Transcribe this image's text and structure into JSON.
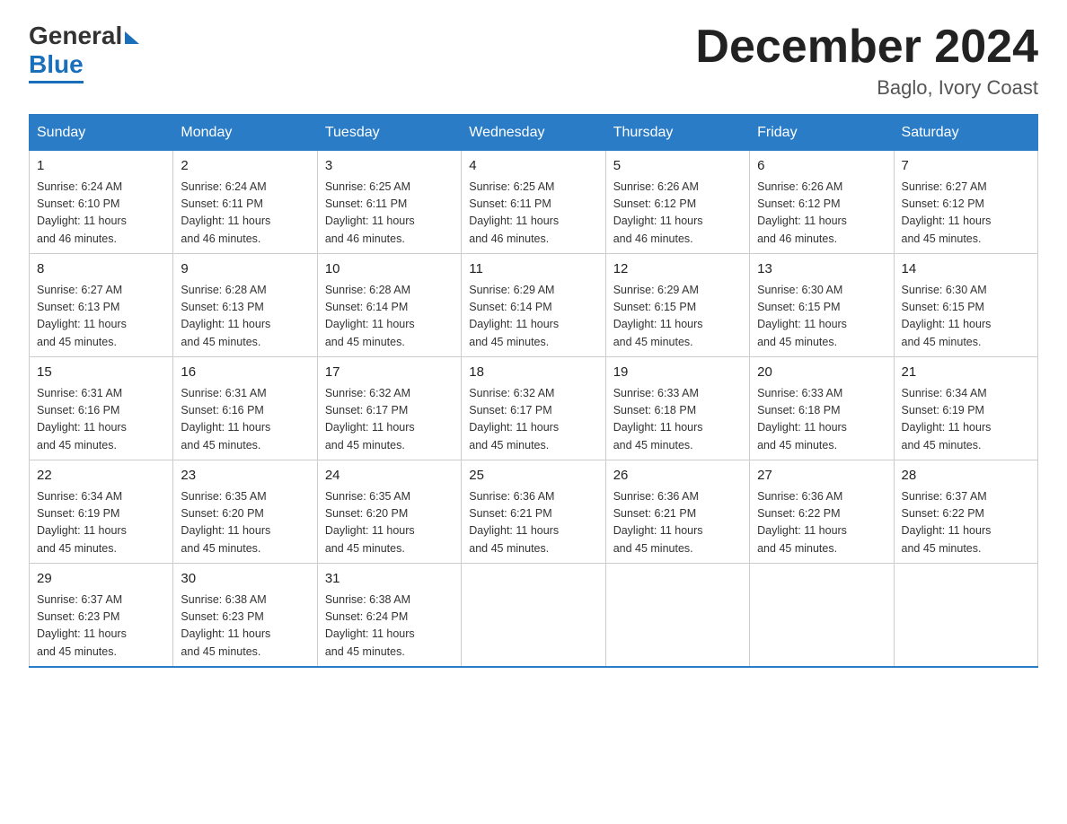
{
  "header": {
    "logo_general": "General",
    "logo_blue": "Blue",
    "month_year": "December 2024",
    "location": "Baglo, Ivory Coast"
  },
  "days_of_week": [
    "Sunday",
    "Monday",
    "Tuesday",
    "Wednesday",
    "Thursday",
    "Friday",
    "Saturday"
  ],
  "weeks": [
    [
      {
        "day": "1",
        "sunrise": "6:24 AM",
        "sunset": "6:10 PM",
        "daylight": "11 hours and 46 minutes."
      },
      {
        "day": "2",
        "sunrise": "6:24 AM",
        "sunset": "6:11 PM",
        "daylight": "11 hours and 46 minutes."
      },
      {
        "day": "3",
        "sunrise": "6:25 AM",
        "sunset": "6:11 PM",
        "daylight": "11 hours and 46 minutes."
      },
      {
        "day": "4",
        "sunrise": "6:25 AM",
        "sunset": "6:11 PM",
        "daylight": "11 hours and 46 minutes."
      },
      {
        "day": "5",
        "sunrise": "6:26 AM",
        "sunset": "6:12 PM",
        "daylight": "11 hours and 46 minutes."
      },
      {
        "day": "6",
        "sunrise": "6:26 AM",
        "sunset": "6:12 PM",
        "daylight": "11 hours and 46 minutes."
      },
      {
        "day": "7",
        "sunrise": "6:27 AM",
        "sunset": "6:12 PM",
        "daylight": "11 hours and 45 minutes."
      }
    ],
    [
      {
        "day": "8",
        "sunrise": "6:27 AM",
        "sunset": "6:13 PM",
        "daylight": "11 hours and 45 minutes."
      },
      {
        "day": "9",
        "sunrise": "6:28 AM",
        "sunset": "6:13 PM",
        "daylight": "11 hours and 45 minutes."
      },
      {
        "day": "10",
        "sunrise": "6:28 AM",
        "sunset": "6:14 PM",
        "daylight": "11 hours and 45 minutes."
      },
      {
        "day": "11",
        "sunrise": "6:29 AM",
        "sunset": "6:14 PM",
        "daylight": "11 hours and 45 minutes."
      },
      {
        "day": "12",
        "sunrise": "6:29 AM",
        "sunset": "6:15 PM",
        "daylight": "11 hours and 45 minutes."
      },
      {
        "day": "13",
        "sunrise": "6:30 AM",
        "sunset": "6:15 PM",
        "daylight": "11 hours and 45 minutes."
      },
      {
        "day": "14",
        "sunrise": "6:30 AM",
        "sunset": "6:15 PM",
        "daylight": "11 hours and 45 minutes."
      }
    ],
    [
      {
        "day": "15",
        "sunrise": "6:31 AM",
        "sunset": "6:16 PM",
        "daylight": "11 hours and 45 minutes."
      },
      {
        "day": "16",
        "sunrise": "6:31 AM",
        "sunset": "6:16 PM",
        "daylight": "11 hours and 45 minutes."
      },
      {
        "day": "17",
        "sunrise": "6:32 AM",
        "sunset": "6:17 PM",
        "daylight": "11 hours and 45 minutes."
      },
      {
        "day": "18",
        "sunrise": "6:32 AM",
        "sunset": "6:17 PM",
        "daylight": "11 hours and 45 minutes."
      },
      {
        "day": "19",
        "sunrise": "6:33 AM",
        "sunset": "6:18 PM",
        "daylight": "11 hours and 45 minutes."
      },
      {
        "day": "20",
        "sunrise": "6:33 AM",
        "sunset": "6:18 PM",
        "daylight": "11 hours and 45 minutes."
      },
      {
        "day": "21",
        "sunrise": "6:34 AM",
        "sunset": "6:19 PM",
        "daylight": "11 hours and 45 minutes."
      }
    ],
    [
      {
        "day": "22",
        "sunrise": "6:34 AM",
        "sunset": "6:19 PM",
        "daylight": "11 hours and 45 minutes."
      },
      {
        "day": "23",
        "sunrise": "6:35 AM",
        "sunset": "6:20 PM",
        "daylight": "11 hours and 45 minutes."
      },
      {
        "day": "24",
        "sunrise": "6:35 AM",
        "sunset": "6:20 PM",
        "daylight": "11 hours and 45 minutes."
      },
      {
        "day": "25",
        "sunrise": "6:36 AM",
        "sunset": "6:21 PM",
        "daylight": "11 hours and 45 minutes."
      },
      {
        "day": "26",
        "sunrise": "6:36 AM",
        "sunset": "6:21 PM",
        "daylight": "11 hours and 45 minutes."
      },
      {
        "day": "27",
        "sunrise": "6:36 AM",
        "sunset": "6:22 PM",
        "daylight": "11 hours and 45 minutes."
      },
      {
        "day": "28",
        "sunrise": "6:37 AM",
        "sunset": "6:22 PM",
        "daylight": "11 hours and 45 minutes."
      }
    ],
    [
      {
        "day": "29",
        "sunrise": "6:37 AM",
        "sunset": "6:23 PM",
        "daylight": "11 hours and 45 minutes."
      },
      {
        "day": "30",
        "sunrise": "6:38 AM",
        "sunset": "6:23 PM",
        "daylight": "11 hours and 45 minutes."
      },
      {
        "day": "31",
        "sunrise": "6:38 AM",
        "sunset": "6:24 PM",
        "daylight": "11 hours and 45 minutes."
      },
      null,
      null,
      null,
      null
    ]
  ],
  "labels": {
    "sunrise": "Sunrise:",
    "sunset": "Sunset:",
    "daylight": "Daylight:"
  }
}
